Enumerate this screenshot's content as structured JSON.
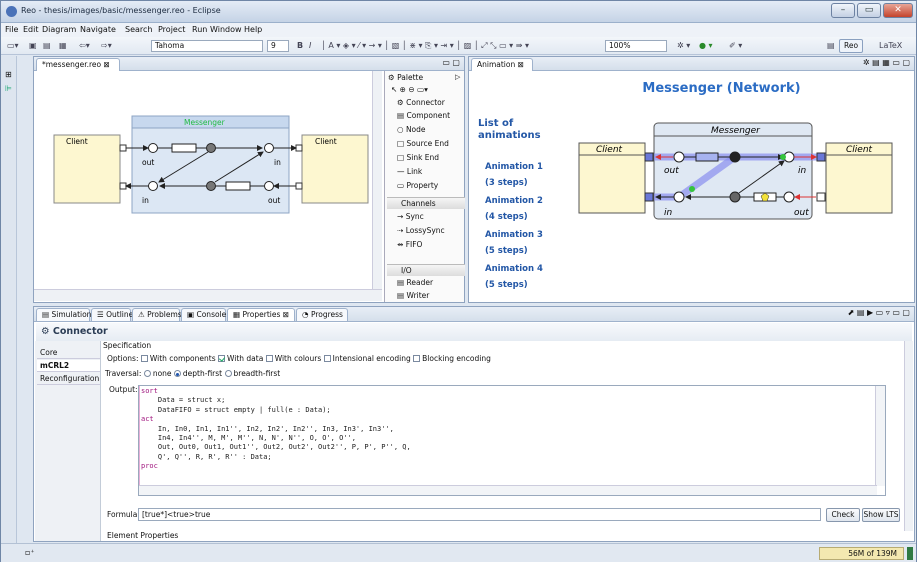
{
  "window": {
    "title": "Reo - thesis/images/basic/messenger.reo - Eclipse",
    "minimize": "–",
    "maximize": "▭",
    "close": "✕"
  },
  "menu": [
    "File",
    "Edit",
    "Diagram",
    "Navigate",
    "Search",
    "Project",
    "Run",
    "Window",
    "Help"
  ],
  "toolbar": {
    "font_name": "Tahoma",
    "font_size": "9",
    "bold": "B",
    "italic": "I",
    "zoom": "100%",
    "perspective_reo": "Reo",
    "perspective_latex": "LaTeX"
  },
  "editor": {
    "tab_label": "*messenger.reo",
    "diagram": {
      "connector_name": "Messenger",
      "client_left": "Client",
      "client_right": "Client",
      "port_out_left": "out",
      "port_in_left": "in",
      "port_in_right": "in",
      "port_out_right": "out"
    }
  },
  "palette": {
    "title": "Palette",
    "items": [
      "Connector",
      "Component",
      "Node",
      "Source End",
      "Sink End",
      "Link",
      "Property"
    ],
    "channels_header": "Channels",
    "channels": [
      "Sync",
      "LossySync",
      "FIFO"
    ],
    "io_header": "I/O",
    "io": [
      "Reader",
      "Writer"
    ]
  },
  "animation": {
    "tab_label": "Animation",
    "title": "Messenger (Network)",
    "list_heading": "List of animations",
    "items": [
      {
        "name": "Animation 1",
        "steps": "(3 steps)"
      },
      {
        "name": "Animation 2",
        "steps": "(4 steps)"
      },
      {
        "name": "Animation 3",
        "steps": "(5 steps)"
      },
      {
        "name": "Animation 4",
        "steps": "(5 steps)"
      }
    ],
    "diagram": {
      "connector_name": "Messenger",
      "client_left": "Client",
      "client_right": "Client",
      "port_out_left": "out",
      "port_in_left": "in",
      "port_in_right": "in",
      "port_out_right": "out"
    }
  },
  "bottom_tabs": [
    "Simulation",
    "Outline",
    "Problems",
    "Console",
    "Properties",
    "Progress"
  ],
  "properties": {
    "header": "Connector",
    "side_tabs": [
      "Core",
      "mCRL2",
      "Reconfiguration"
    ],
    "selected_side_tab": "mCRL2",
    "specification_label": "Specification",
    "options_label": "Options:",
    "options": [
      {
        "label": "With components",
        "checked": false
      },
      {
        "label": "With data",
        "checked": true
      },
      {
        "label": "With colours",
        "checked": false
      },
      {
        "label": "Intensional encoding",
        "checked": false
      },
      {
        "label": "Blocking encoding",
        "checked": false
      }
    ],
    "traversal_label": "Traversal:",
    "traversal": [
      {
        "label": "none",
        "selected": false
      },
      {
        "label": "depth-first",
        "selected": true
      },
      {
        "label": "breadth-first",
        "selected": false
      }
    ],
    "output_label": "Output:",
    "output_lines": [
      {
        "text": "sort",
        "kw": true
      },
      {
        "text": "    Data = struct x;",
        "kw": false
      },
      {
        "text": "    DataFIFO = struct empty | full(e : Data);",
        "kw": false
      },
      {
        "text": "",
        "kw": false
      },
      {
        "text": "act",
        "kw": true
      },
      {
        "text": "    In, In0, In1, In1'', In2, In2', In2'', In3, In3', In3'',",
        "kw": false
      },
      {
        "text": "    In4, In4'', M, M', M'', N, N', N'', O, O', O'',",
        "kw": false
      },
      {
        "text": "    Out, Out0, Out1, Out1'', Out2, Out2', Out2'', P, P', P'', Q,",
        "kw": false
      },
      {
        "text": "    Q', Q'', R, R', R'' : Data;",
        "kw": false
      },
      {
        "text": "",
        "kw": false
      },
      {
        "text": "proc",
        "kw": true
      }
    ],
    "formula_label": "Formula:",
    "formula_value": "[true*]<true>true",
    "check_button": "Check",
    "show_lts_button": "Show LTS",
    "element_properties": "Element Properties"
  },
  "status": {
    "memory": "56M of 139M"
  }
}
